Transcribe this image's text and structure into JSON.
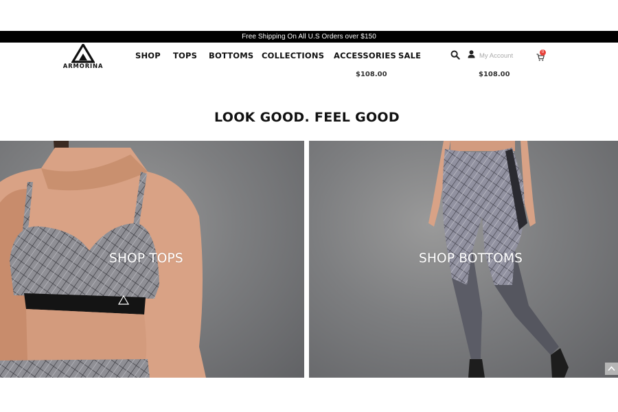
{
  "announcement": "Free Shipping  On All  U.S Orders over $150",
  "brand": {
    "name": "ARMORINA"
  },
  "nav": {
    "items": [
      {
        "label": "SHOP"
      },
      {
        "label": "TOPS"
      },
      {
        "label": "BOTTOMS"
      },
      {
        "label": "COLLECTIONS"
      },
      {
        "label": "ACCESSORIES",
        "price": "$108.00"
      },
      {
        "label": "SALE"
      }
    ],
    "stray_price": "$108.00"
  },
  "header_actions": {
    "search_icon": "search-icon",
    "user_icon": "user-icon",
    "account_label": "My Account",
    "cart_icon": "cart-icon",
    "cart_count": "0"
  },
  "headline": "LOOK GOOD. FEEL GOOD",
  "panels": {
    "tops": {
      "label": "SHOP TOPS"
    },
    "bottoms": {
      "label": "SHOP BOTTOMS"
    }
  },
  "colors": {
    "topbar_bg": "#000000",
    "cart_badge": "#e8423b",
    "panel_bg": "#7d7e80"
  }
}
